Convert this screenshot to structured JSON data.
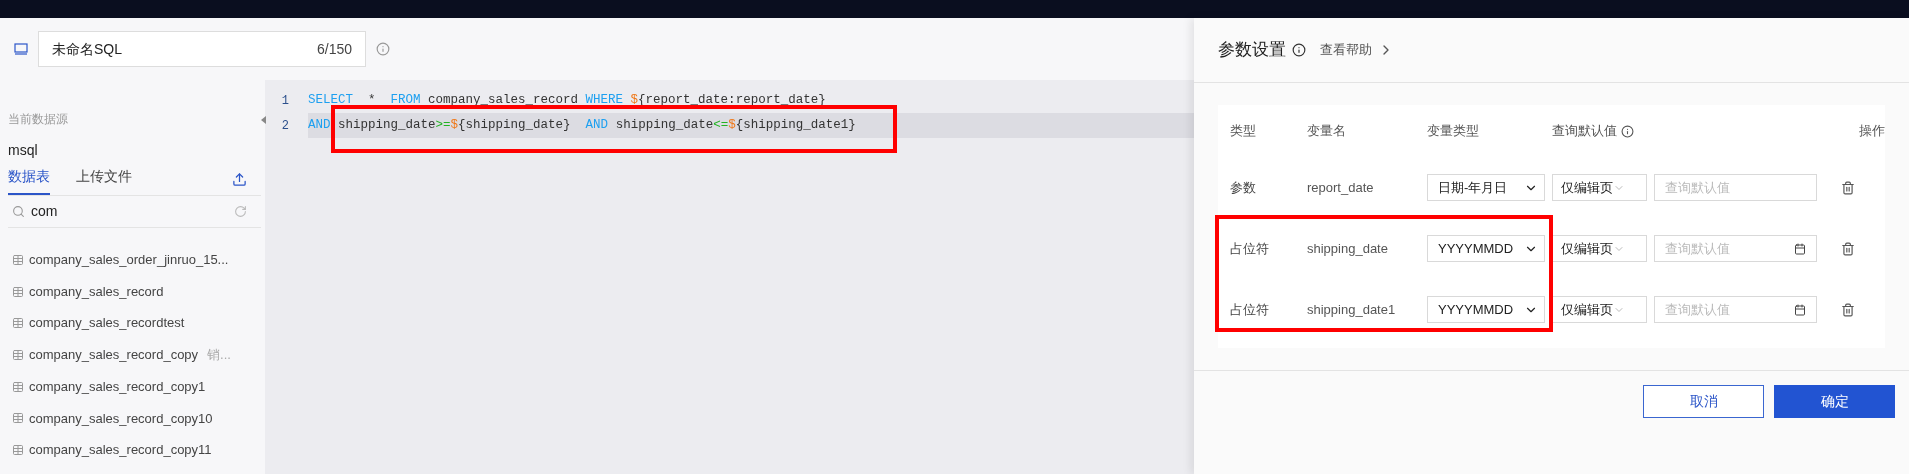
{
  "header": {
    "sql_name": "未命名SQL",
    "counter": "6/150"
  },
  "sidebar": {
    "section_label": "当前数据源",
    "datasource": "msql",
    "tabs": [
      {
        "label": "数据表",
        "selected": true
      },
      {
        "label": "上传文件",
        "selected": false
      }
    ],
    "search": {
      "value": "com"
    },
    "tables": [
      {
        "name": "company_sales_order_jinruo_15..."
      },
      {
        "name": "company_sales_record"
      },
      {
        "name": "company_sales_recordtest"
      },
      {
        "name": "company_sales_record_copy",
        "note": "销..."
      },
      {
        "name": "company_sales_record_copy1"
      },
      {
        "name": "company_sales_record_copy10"
      },
      {
        "name": "company_sales_record_copy11"
      }
    ]
  },
  "editor": {
    "lines": [
      {
        "number": "1",
        "selected": false,
        "tokens": [
          {
            "kind": "keyword",
            "text": "SELECT"
          },
          {
            "kind": "text",
            "text": "  *  "
          },
          {
            "kind": "keyword",
            "text": "FROM"
          },
          {
            "kind": "text",
            "text": " company_sales_record "
          },
          {
            "kind": "keyword",
            "text": "WHERE"
          },
          {
            "kind": "dollar",
            "text": " $"
          },
          {
            "kind": "text",
            "text": "{report_date:report_date}"
          }
        ]
      },
      {
        "number": "2",
        "selected": true,
        "tokens": [
          {
            "kind": "keyword",
            "text": "AND"
          },
          {
            "kind": "text",
            "text": " shipping_date"
          },
          {
            "kind": "op",
            "text": ">="
          },
          {
            "kind": "dollar",
            "text": "$"
          },
          {
            "kind": "text",
            "text": "{shipping_date}  "
          },
          {
            "kind": "keyword",
            "text": "AND"
          },
          {
            "kind": "text",
            "text": " shipping_date"
          },
          {
            "kind": "op",
            "text": "<="
          },
          {
            "kind": "dollar",
            "text": "$"
          },
          {
            "kind": "text",
            "text": "{shipping_date1}"
          }
        ]
      }
    ]
  },
  "params_panel": {
    "title": "参数设置",
    "help_link": "查看帮助",
    "columns": [
      {
        "label": "类型"
      },
      {
        "label": "变量名"
      },
      {
        "label": "变量类型"
      },
      {
        "label": "查询默认值",
        "info": true
      },
      {
        "label": "操作"
      }
    ],
    "rows": [
      {
        "type": "参数",
        "name": "report_date",
        "var_type": "日期-年月日",
        "scope": "仅编辑页",
        "placeholder": "查询默认值",
        "calendar": false
      },
      {
        "type": "占位符",
        "name": "shipping_date",
        "var_type": "YYYYMMDD",
        "scope": "仅编辑页",
        "placeholder": "查询默认值",
        "calendar": true
      },
      {
        "type": "占位符",
        "name": "shipping_date1",
        "var_type": "YYYYMMDD",
        "scope": "仅编辑页",
        "placeholder": "查询默认值",
        "calendar": true
      }
    ],
    "buttons": [
      {
        "label": "取消",
        "kind": "secondary"
      },
      {
        "label": "确定",
        "kind": "primary"
      }
    ]
  }
}
